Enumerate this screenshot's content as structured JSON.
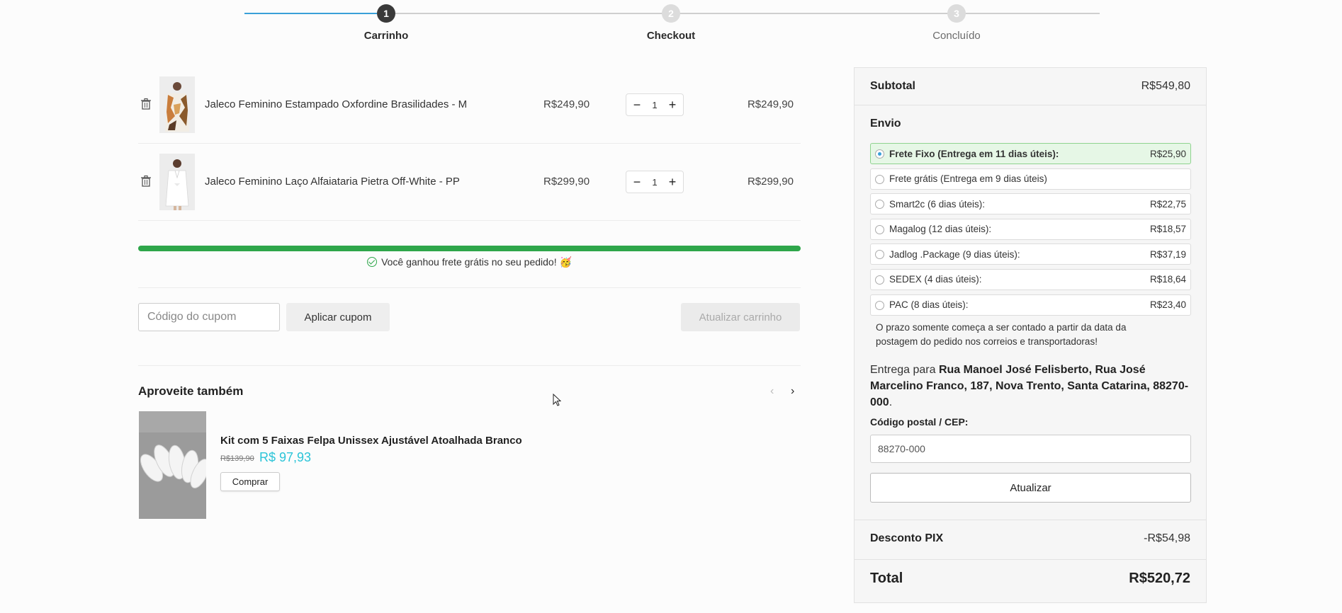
{
  "steps": [
    {
      "num": "1",
      "label": "Carrinho"
    },
    {
      "num": "2",
      "label": "Checkout"
    },
    {
      "num": "3",
      "label": "Concluído"
    }
  ],
  "cart": {
    "items": [
      {
        "name": "Jaleco Feminino Estampado Oxfordine Brasilidades - M",
        "price": "R$249,90",
        "qty": "1",
        "total": "R$249,90"
      },
      {
        "name": "Jaleco Feminino Laço Alfaiataria Pietra Off-White - PP",
        "price": "R$299,90",
        "qty": "1",
        "total": "R$299,90"
      }
    ],
    "minus_symbol": "−",
    "plus_symbol": "+"
  },
  "free_shipping": {
    "progress": 1.0,
    "message": "Você ganhou frete grátis no seu pedido! 🥳"
  },
  "coupon": {
    "placeholder": "Código do cupom",
    "apply_label": "Aplicar cupom",
    "update_cart_label": "Atualizar carrinho"
  },
  "upsell": {
    "title": "Aproveite também",
    "prev_arrow": "‹",
    "next_arrow": "›",
    "product": {
      "name": "Kit com 5 Faixas Felpa Unissex Ajustável Atoalhada Branco",
      "old_price": "R$139,90",
      "new_price": "R$ 97,93",
      "buy_label": "Comprar"
    }
  },
  "summary": {
    "subtotal_label": "Subtotal",
    "subtotal_value": "R$549,80",
    "shipping_title": "Envio",
    "shipping_options": [
      {
        "label": "Frete Fixo (Entrega em 11 dias úteis):",
        "price": "R$25,90",
        "selected": true
      },
      {
        "label": "Frete grátis (Entrega em 9 dias úteis)",
        "price": "",
        "selected": false
      },
      {
        "label": "Smart2c (6 dias úteis):",
        "price": "R$22,75",
        "selected": false
      },
      {
        "label": "Magalog (12 dias úteis):",
        "price": "R$18,57",
        "selected": false
      },
      {
        "label": "Jadlog .Package (9 dias úteis):",
        "price": "R$37,19",
        "selected": false
      },
      {
        "label": "SEDEX (4 dias úteis):",
        "price": "R$18,64",
        "selected": false
      },
      {
        "label": "PAC (8 dias úteis):",
        "price": "R$23,40",
        "selected": false
      }
    ],
    "shipping_note": "O prazo somente começa a ser contado a partir da data da postagem do pedido nos correios e transportadoras!",
    "delivery_prefix": "Entrega para ",
    "delivery_address": "Rua Manoel José Felisberto, Rua José Marcelino Franco, 187, Nova Trento, Santa Catarina, 88270-000",
    "delivery_suffix": ".",
    "cep_label": "Código postal / CEP:",
    "cep_value": "88270-000",
    "update_label": "Atualizar",
    "discount_label": "Desconto PIX",
    "discount_value": "-R$54,98",
    "total_label": "Total",
    "total_value": "R$520,72"
  },
  "colors": {
    "accent": "#3aa0d8",
    "progress_green": "#2ea64a",
    "sale_price": "#2bc4d8",
    "selected_option_bg": "#e6f7e6"
  }
}
